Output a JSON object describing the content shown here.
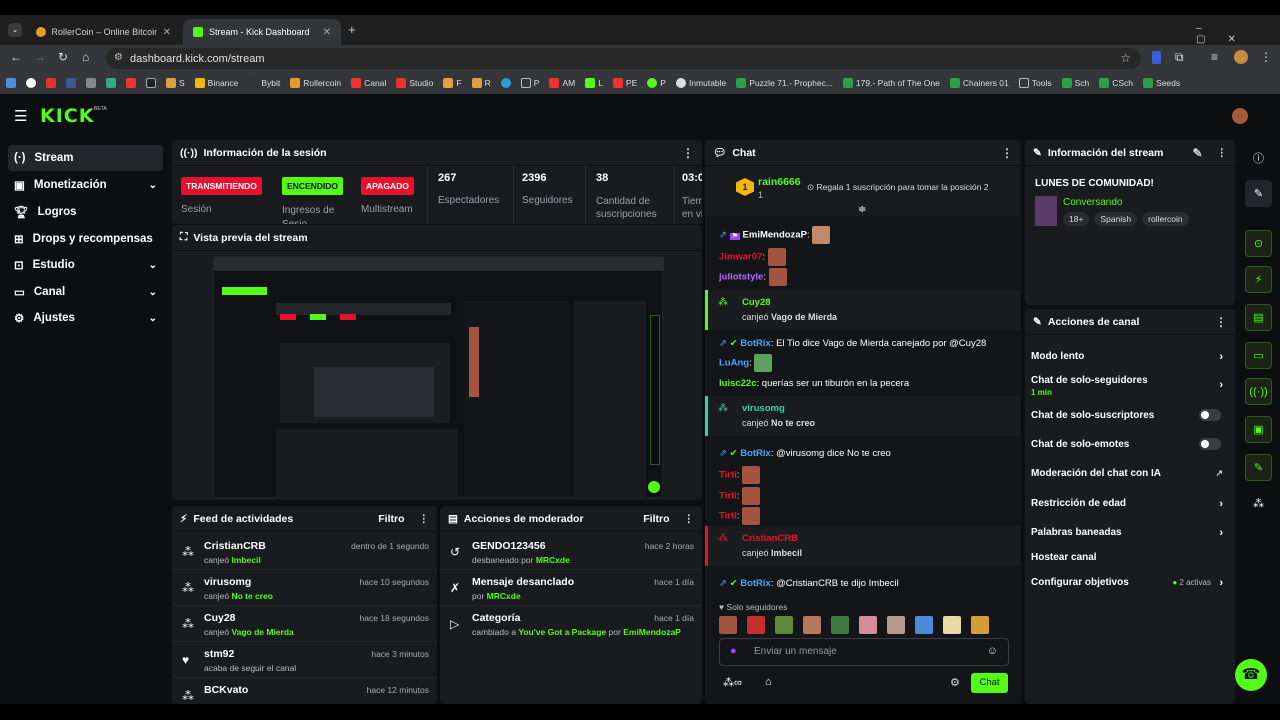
{
  "browser": {
    "tabs": [
      {
        "title": "RollerCoin – Online Bitcoin Mini",
        "icon": "rollercoin-icon"
      },
      {
        "title": "Stream - Kick Dashboard",
        "icon": "kick-icon"
      }
    ],
    "url": "dashboard.kick.com/stream",
    "bookmarks": [
      "Binance",
      "Bybit",
      "Rollercoin",
      "Canal",
      "Studio",
      "F",
      "R",
      "P",
      "AM",
      "L",
      "PE",
      "P",
      "Inmutable",
      "Puzzle 71.- Prophec...",
      "179.- Path of The One",
      "Chainers 01",
      "Tools",
      "Sch",
      "CSch",
      "Seeds"
    ],
    "bookmark_letters": [
      "S"
    ]
  },
  "nav": {
    "logo": "KICK",
    "logo_beta": "BETA",
    "items": [
      {
        "label": "Stream",
        "icon": "stream-icon"
      },
      {
        "label": "Monetización",
        "icon": "monetization-icon"
      },
      {
        "label": "Logros",
        "icon": "trophy-icon"
      },
      {
        "label": "Drops y recompensas",
        "icon": "drops-icon"
      },
      {
        "label": "Estudio",
        "icon": "studio-icon"
      },
      {
        "label": "Canal",
        "icon": "channel-icon"
      },
      {
        "label": "Ajustes",
        "icon": "settings-icon"
      }
    ]
  },
  "session": {
    "title": "Información de la sesión",
    "stats": [
      {
        "badge": "TRANSMITIENDO",
        "label": "Sesión"
      },
      {
        "badge": "ENCENDIDO",
        "label": "Ingresos de Sesio"
      },
      {
        "badge": "APAGADO",
        "label": "Multistream"
      },
      {
        "value": "267",
        "label": "Espectadores"
      },
      {
        "value": "2396",
        "label": "Seguidores"
      },
      {
        "value": "38",
        "label": "Cantidad de suscripciones"
      },
      {
        "value": "03:0",
        "label": "Tiem en vi"
      }
    ]
  },
  "preview": {
    "title": "Vista previa del stream"
  },
  "feed": {
    "title": "Feed de actividades",
    "filter": "Filtro",
    "items": [
      {
        "name": "CristianCRB",
        "action": "canjeó",
        "reward": "Imbecil",
        "time": "dentro de 1 segundo"
      },
      {
        "name": "virusomg",
        "action": "canjeó",
        "reward": "No te creo",
        "time": "hace 10 segundos"
      },
      {
        "name": "Cuy28",
        "action": "canjeó",
        "reward": "Vago de Mierda",
        "time": "hace 18 segundos"
      },
      {
        "name": "stm92",
        "action": "acaba de seguir el canal",
        "reward": "",
        "time": "hace 3 minutos"
      },
      {
        "name": "BCKvato",
        "action": "",
        "reward": "",
        "time": "hace 12 minutos"
      }
    ]
  },
  "mod": {
    "title": "Acciones de moderador",
    "filter": "Filtro",
    "items": [
      {
        "name": "GENDO123456",
        "sub": "desbaneado por",
        "by": "MRCxde",
        "time": "hace 2 horas"
      },
      {
        "name": "Mensaje desanclado",
        "sub": "por",
        "by": "MRCxde",
        "time": "hace 1 día"
      },
      {
        "name": "Categoría",
        "sub": "cambiado a",
        "by": "You've Got a Package",
        "sub2": "por",
        "by2": "EmiMendozaP",
        "time": "hace 1 día"
      }
    ]
  },
  "chat": {
    "title": "Chat",
    "top_gifter": "rain6666",
    "top_gifter_count": "1",
    "gift_prompt": "Regala 1 suscripción para tomar la posición 2",
    "messages": [
      {
        "user": "EmiMendozaP",
        "text": ""
      },
      {
        "user": "Jimwar07",
        "text": ""
      },
      {
        "user": "juliotstyle",
        "text": ""
      },
      {
        "user": "Cuy28",
        "redeem": "canjeó",
        "reward": "Vago de Mierda"
      },
      {
        "user": "BotRix",
        "text": "El Tio dice Vago de Mierda canejado por @Cuy28"
      },
      {
        "user": "LuAng",
        "text": ""
      },
      {
        "user": "luisc22c",
        "text": "querías ser un tiburón en la pecera"
      },
      {
        "user": "virusomg",
        "redeem": "canjeó",
        "reward": "No te creo"
      },
      {
        "user": "BotRix",
        "text": "@virusomg dice No te creo"
      },
      {
        "user": "Tirti",
        "text": ""
      },
      {
        "user": "Tirti",
        "text": ""
      },
      {
        "user": "Tirti",
        "text": ""
      },
      {
        "user": "CristianCRB",
        "redeem": "canjeó",
        "reward": "Imbecil"
      },
      {
        "user": "BotRix",
        "text": "@CristianCRB te dijo Imbecil"
      }
    ],
    "mode": "Solo seguidores",
    "placeholder": "Enviar un mensaje",
    "send": "Chat"
  },
  "streaminfo": {
    "title": "Información del stream",
    "stream_title": "LUNES DE COMUNIDAD!",
    "category": "Conversando",
    "tags": [
      "18+",
      "Spanish",
      "rollercoin"
    ]
  },
  "channel_actions": {
    "title": "Acciones de canal",
    "items": [
      {
        "label": "Modo lento",
        "type": "chevron"
      },
      {
        "label": "Chat de solo-seguidores",
        "sub": "1 min",
        "type": "chevron"
      },
      {
        "label": "Chat de solo-suscriptores",
        "type": "toggle"
      },
      {
        "label": "Chat de solo-emotes",
        "type": "toggle"
      },
      {
        "label": "Moderación del chat con IA",
        "type": "external"
      },
      {
        "label": "Restricción de edad",
        "type": "chevron"
      },
      {
        "label": "Palabras baneadas",
        "type": "chevron"
      },
      {
        "label": "Hostear canal",
        "type": "none"
      },
      {
        "label": "Configurar objetivos",
        "sub": "2 activas",
        "type": "chevron"
      }
    ]
  },
  "colors": {
    "kick_green": "#53fc18",
    "live_red": "#e8112d",
    "panel": "#191b1f"
  }
}
